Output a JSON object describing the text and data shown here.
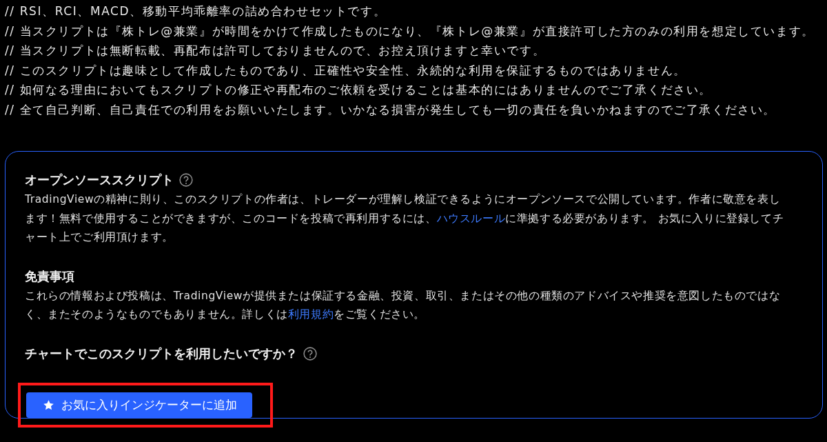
{
  "comments": [
    "// RSI、RCI、MACD、移動平均乖離率の詰め合わせセットです。",
    "// 当スクリプトは『株トレ@兼業』が時間をかけて作成したものになり、『株トレ@兼業』が直接許可した方のみの利用を想定しています。",
    "// 当スクリプトは無断転載、再配布は許可しておりませんので、お控え頂けますと幸いです。",
    "// このスクリプトは趣味として作成したものであり、正確性や安全性、永続的な利用を保証するものではありません。",
    "// 如何なる理由においてもスクリプトの修正や再配布のご依頼を受けることは基本的にはありませんのでご了承ください。",
    "// 全て自己判断、自己責任での利用をお願いいたします。いかなる損害が発生しても一切の責任を負いかねますのでご了承ください。"
  ],
  "card": {
    "sections": [
      {
        "heading": "オープンソーススクリプト",
        "help": true,
        "paragraph": [
          {
            "kind": "text",
            "text": "TradingViewの精神に則り、このスクリプトの作者は、トレーダーが理解し検証できるようにオープンソースで公開しています。作者に敬意を表します！無料で使用することができますが、このコードを投稿で再利用するには、"
          },
          {
            "kind": "link",
            "text": "ハウスルール"
          },
          {
            "kind": "text",
            "text": "に準拠する必要があります。 お気に入りに登録してチャート上でご利用頂けます。"
          }
        ]
      },
      {
        "heading": "免責事項",
        "help": false,
        "paragraph": [
          {
            "kind": "text",
            "text": "これらの情報および投稿は、TradingViewが提供または保証する金融、投資、取引、またはその他の種類のアドバイスや推奨を意図したものではなく、またそのようなものでもありません。詳しくは"
          },
          {
            "kind": "link",
            "text": "利用規約"
          },
          {
            "kind": "text",
            "text": "をご覧ください。"
          }
        ]
      },
      {
        "heading": "チャートでこのスクリプトを利用したいですか？",
        "help": true
      }
    ],
    "button": {
      "label": "お気に入りインジケーターに追加",
      "highlighted": true
    }
  }
}
